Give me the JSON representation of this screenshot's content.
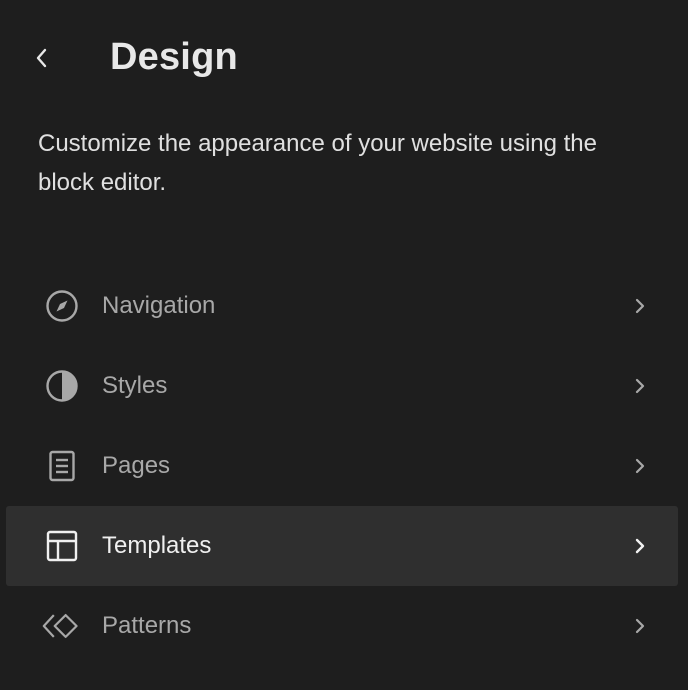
{
  "header": {
    "title": "Design",
    "back_icon": "chevron-left-icon"
  },
  "description": "Customize the appearance of your website using the block editor.",
  "menu": {
    "items": [
      {
        "label": "Navigation",
        "icon": "compass-icon",
        "active": false
      },
      {
        "label": "Styles",
        "icon": "half-circle-icon",
        "active": false
      },
      {
        "label": "Pages",
        "icon": "page-icon",
        "active": false
      },
      {
        "label": "Templates",
        "icon": "layout-icon",
        "active": true
      },
      {
        "label": "Patterns",
        "icon": "diamond-pattern-icon",
        "active": false
      }
    ]
  },
  "colors": {
    "background": "#1e1e1e",
    "active_background": "#2f2f2f",
    "text_primary": "#e0e0e0",
    "text_muted": "#a8a8a8"
  }
}
